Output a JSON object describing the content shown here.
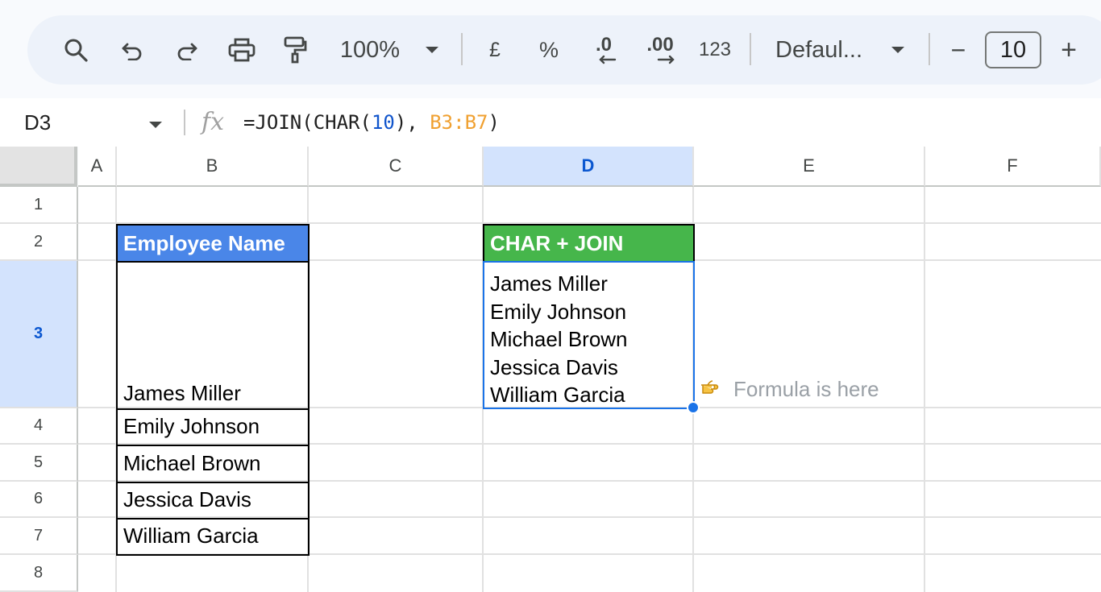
{
  "toolbar": {
    "zoom": "100%",
    "currency": "£",
    "percent": "%",
    "decrease_decimal": ".0",
    "increase_decimal": ".00",
    "number_format": "123",
    "font": "Defaul...",
    "font_size": "10",
    "minus": "−",
    "plus": "+"
  },
  "formula_bar": {
    "cell_ref": "D3",
    "fx": "fx",
    "formula_prefix": "=JOIN(CHAR(",
    "formula_num": "10",
    "formula_mid": "), ",
    "formula_ref": "B3:B7",
    "formula_suffix": ")"
  },
  "columns": [
    "A",
    "B",
    "C",
    "D",
    "E",
    "F"
  ],
  "rows": [
    "1",
    "2",
    "3",
    "4",
    "5",
    "6",
    "7",
    "8"
  ],
  "active_cell": {
    "column": "D",
    "row": "3"
  },
  "cells": {
    "B2": "Employee Name",
    "B3": "James Miller",
    "B4": "Emily Johnson",
    "B5": "Michael Brown",
    "B6": "Jessica Davis",
    "B7": "William Garcia",
    "D2": "CHAR + JOIN",
    "D3_lines": [
      "James Miller",
      "Emily Johnson",
      "Michael Brown",
      "Jessica Davis",
      "William Garcia"
    ]
  },
  "annotation": {
    "icon": "pointing-hand-icon",
    "text": "Formula is here"
  },
  "colors": {
    "header_blue": "#4a86e8",
    "header_green": "#46b64b",
    "selection": "#1a73e8",
    "active_header": "#d3e3fd"
  }
}
